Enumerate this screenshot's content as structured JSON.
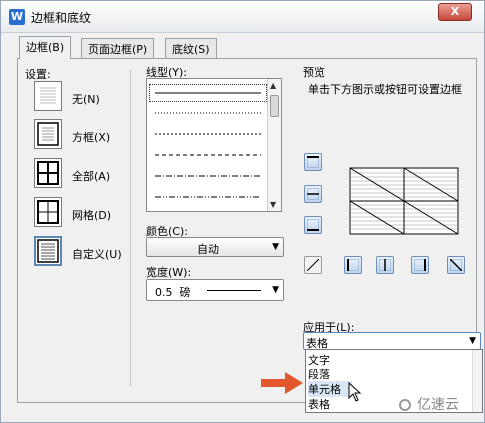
{
  "window": {
    "title": "边框和底纹",
    "close_label": "X"
  },
  "tabs": [
    {
      "label": "边框(B)",
      "active": true
    },
    {
      "label": "页面边框(P)",
      "active": false
    },
    {
      "label": "底纹(S)",
      "active": false
    }
  ],
  "settings": {
    "label": "设置:",
    "items": [
      {
        "label": "无(N)",
        "selected": false
      },
      {
        "label": "方框(X)",
        "selected": false
      },
      {
        "label": "全部(A)",
        "selected": false
      },
      {
        "label": "网格(D)",
        "selected": false
      },
      {
        "label": "自定义(U)",
        "selected": true
      }
    ]
  },
  "line_style": {
    "label": "线型(Y):",
    "options": [
      "solid",
      "dotted",
      "dotted-dense",
      "dashed-short",
      "dash-dot",
      "dash-dot-dot",
      "dashed-long"
    ],
    "selected": "solid"
  },
  "color": {
    "label": "颜色(C):",
    "value": "自动"
  },
  "width": {
    "label": "宽度(W):",
    "value": "0.5  磅"
  },
  "preview": {
    "label": "预览",
    "hint": "单击下方图示或按钮可设置边框"
  },
  "apply_to": {
    "label": "应用于(L):",
    "value": "表格",
    "options": [
      "文字",
      "段落",
      "单元格",
      "表格"
    ],
    "highlighted": "单元格"
  },
  "watermark": "亿速云",
  "colors": {
    "accent": "#2b6fd1",
    "arrow": "#e2572b",
    "selection": "#d8e6f6"
  }
}
